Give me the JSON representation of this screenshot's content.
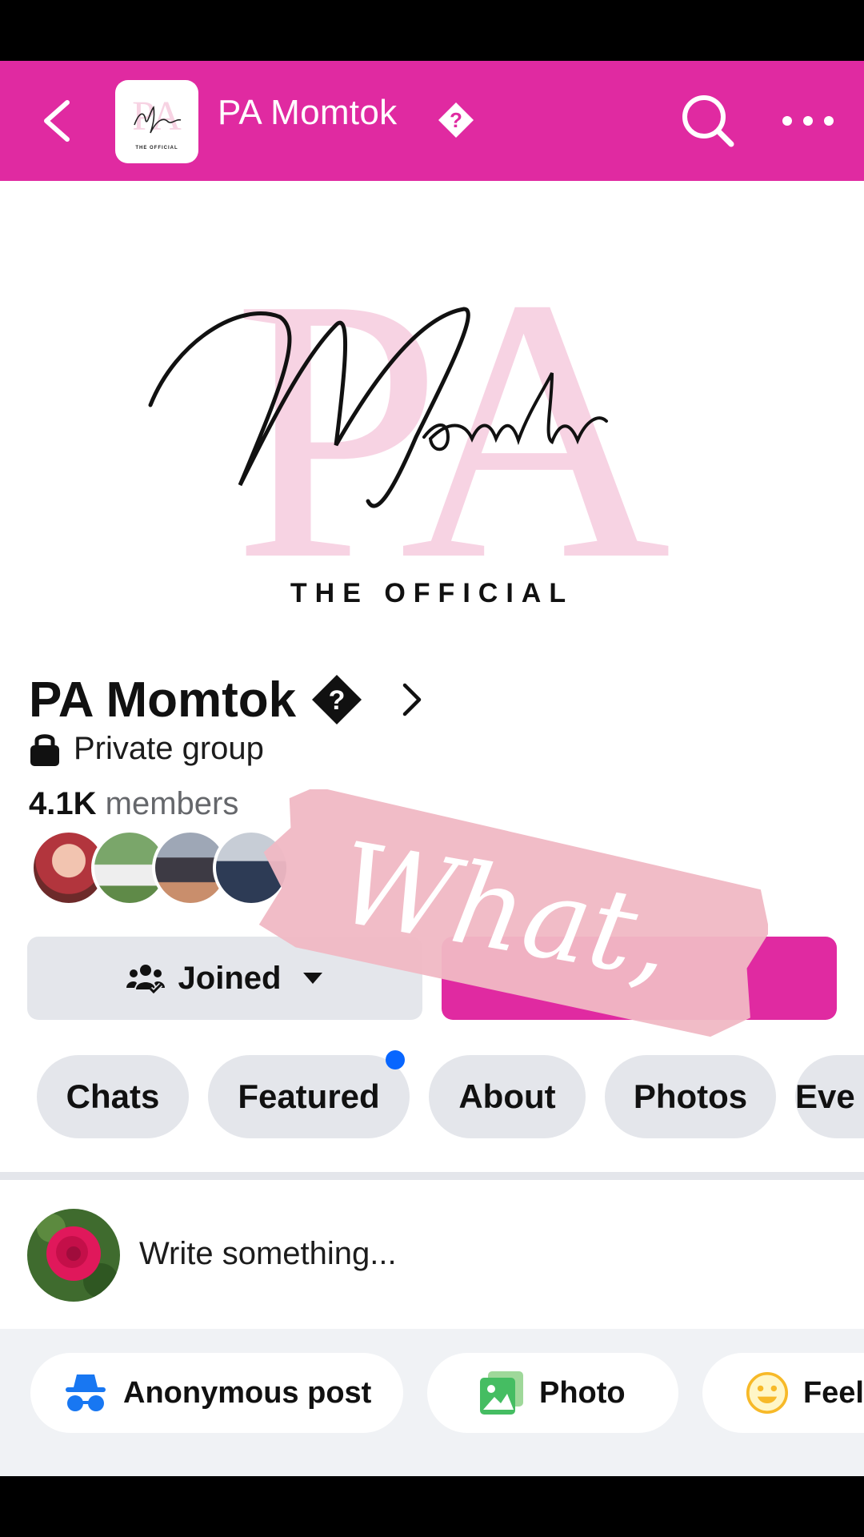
{
  "topbar": {
    "title": "PA Momtok",
    "background": "#e02aa1"
  },
  "cover": {
    "logo_letters": "PA",
    "logo_script": "Momtok",
    "tagline": "THE OFFICIAL",
    "logo_color": "#f7d3e3"
  },
  "group": {
    "name": "PA Momtok",
    "privacy": "Private group",
    "members_count": "4.1K",
    "members_label": "members"
  },
  "actions": {
    "joined_label": "Joined",
    "invite_color": "#e02aa1"
  },
  "sticker": {
    "text": "What,",
    "color": "#f0b8c4"
  },
  "tabs": [
    {
      "label": "Chats",
      "has_dot": false
    },
    {
      "label": "Featured",
      "has_dot": true
    },
    {
      "label": "About",
      "has_dot": false
    },
    {
      "label": "Photos",
      "has_dot": false
    },
    {
      "label": "Eve",
      "has_dot": false
    }
  ],
  "composer": {
    "placeholder": "Write something..."
  },
  "post_options": [
    {
      "label": "Anonymous post",
      "icon": "anonymous-icon"
    },
    {
      "label": "Photo",
      "icon": "photo-icon"
    },
    {
      "label": "Feel",
      "icon": "feeling-icon"
    }
  ]
}
